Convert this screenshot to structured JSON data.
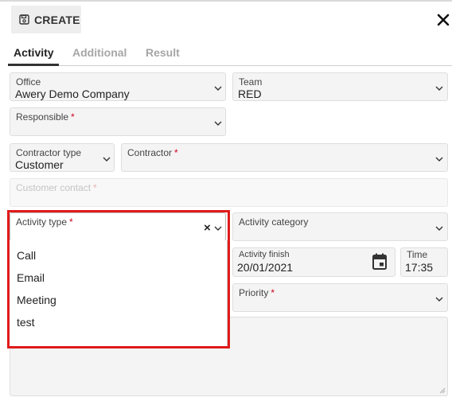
{
  "header": {
    "create_label": "CREATE",
    "close_icon": "close-icon",
    "save_icon": "floppy-disk-icon"
  },
  "tabs": [
    {
      "label": "Activity",
      "active": true
    },
    {
      "label": "Additional",
      "active": false
    },
    {
      "label": "Result",
      "active": false
    }
  ],
  "form": {
    "office": {
      "label": "Office",
      "value": "Awery Demo Company"
    },
    "team": {
      "label": "Team",
      "value": "RED"
    },
    "responsible": {
      "label": "Responsible",
      "required": "*"
    },
    "contractor_type": {
      "label": "Contractor type",
      "value": "Customer"
    },
    "contractor": {
      "label": "Contractor",
      "required": "*"
    },
    "customer_contact": {
      "label": "Customer contact",
      "required": "*"
    },
    "activity_type": {
      "label": "Activity type",
      "required": "*",
      "clear": "×"
    },
    "activity_category": {
      "label": "Activity category"
    },
    "activity_finish": {
      "label": "Activity finish",
      "value": "20/01/2021"
    },
    "time": {
      "label": "Time",
      "value": "17:35"
    },
    "priority": {
      "label": "Priority",
      "required": "*"
    }
  },
  "activity_type_options": [
    "Call",
    "Email",
    "Meeting",
    "test"
  ],
  "colors": {
    "highlight": "#e01b1b",
    "required": "#d0021b",
    "field_bg": "#f4f4f4"
  }
}
